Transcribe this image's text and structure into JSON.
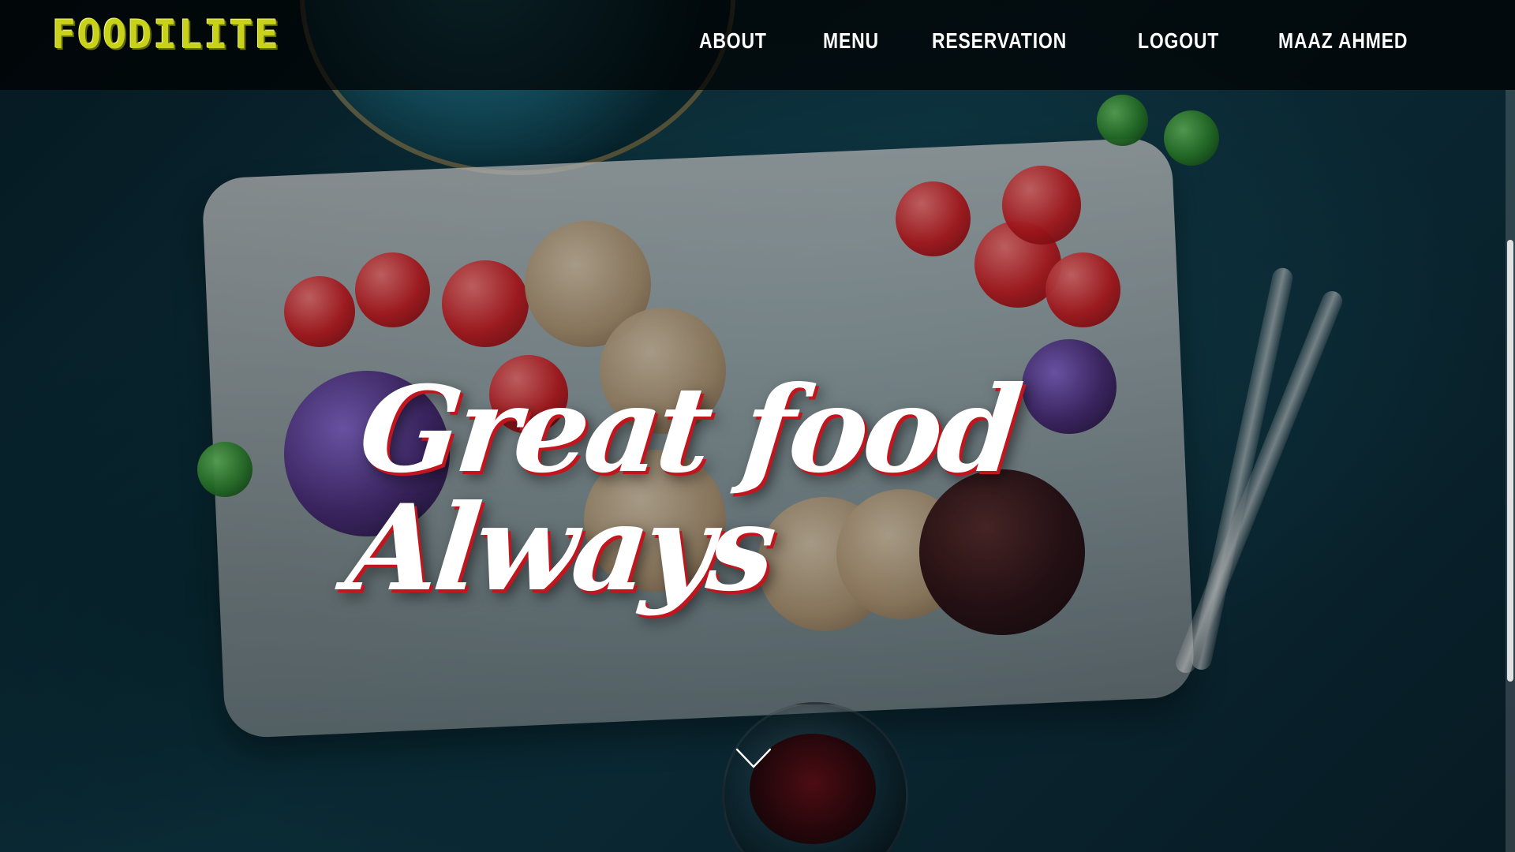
{
  "brand": {
    "name": "FOODILITE"
  },
  "nav": {
    "items": [
      {
        "label": "ABOUT"
      },
      {
        "label": "MENU"
      },
      {
        "label": "RESERVATION"
      },
      {
        "label": "LOGOUT"
      },
      {
        "label": "MAAZ AHMED"
      }
    ]
  },
  "hero": {
    "headline": "Great food Always"
  },
  "colors": {
    "brand_yellow": "#c9d21a",
    "headline_red": "#c2161f",
    "topbar_bg": "#000000"
  },
  "icons": {
    "scroll_down": "chevron-down-icon"
  }
}
